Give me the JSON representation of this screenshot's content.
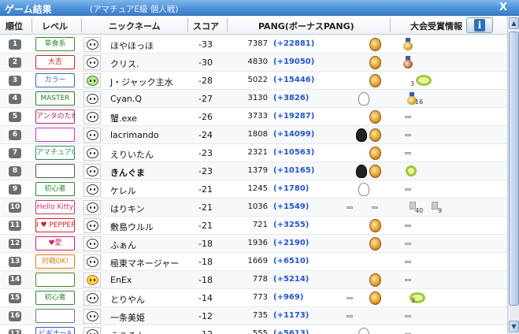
{
  "window": {
    "title": "ゲーム結果",
    "subtitle": "(アマチュアE級 個人戦)",
    "close_label": "X"
  },
  "header": {
    "rank": "順位",
    "level": "レベル",
    "nickname": "ニックネーム",
    "score": "スコア",
    "pang": "PANG(ボーナスPANG)",
    "tournament_info": "大会受賞情報",
    "info_icon_label": "i"
  },
  "rows": [
    {
      "rank": "1",
      "level": "草食系",
      "nickname": "ほやほっほ",
      "score": "-33",
      "pang": "7387",
      "bonus": "(+22881)",
      "level_color": "#2e8b2e"
    },
    {
      "rank": "2",
      "level": "大吉",
      "nickname": "クリス.",
      "score": "-30",
      "pang": "4830",
      "bonus": "(+19050)",
      "level_color": "#cc2222"
    },
    {
      "rank": "3",
      "level": "カラー",
      "nickname": "J・ジャック主水",
      "score": "-28",
      "pang": "5022",
      "bonus": "(+15446)",
      "level_color": "#3a6ab0",
      "ring_count": "3"
    },
    {
      "rank": "4",
      "level": "MASTER",
      "nickname": "Cyan.Q",
      "score": "-27",
      "pang": "3130",
      "bonus": "(+3826)",
      "level_color": "#2a7a2a",
      "trophy_count": "16"
    },
    {
      "rank": "5",
      "level": "アンタのためじゃないんだからね!",
      "nickname": "蟹.exe",
      "score": "-26",
      "pang": "3733",
      "bonus": "(+19287)",
      "level_color": "#aa2266"
    },
    {
      "rank": "6",
      "level": "",
      "nickname": "lacrimando",
      "score": "-24",
      "pang": "1808",
      "bonus": "(+14099)",
      "level_color": "#cc33cc"
    },
    {
      "rank": "7",
      "level": "アマチュアC",
      "nickname": "えりいたん",
      "score": "-23",
      "pang": "2321",
      "bonus": "(+10563)",
      "level_color": "#2e8b57"
    },
    {
      "rank": "8",
      "level": "",
      "nickname": "きんぐま",
      "score": "-23",
      "pang": "1379",
      "bonus": "(+10165)",
      "level_color": "#555555",
      "bold": true
    },
    {
      "rank": "9",
      "level": "初心者",
      "nickname": "ケレル",
      "score": "-21",
      "pang": "1245",
      "bonus": "(+1780)",
      "level_color": "#2a8a2a"
    },
    {
      "rank": "10",
      "level": "Hello Kitty",
      "nickname": "はりキン",
      "score": "-21",
      "pang": "1036",
      "bonus": "(+1549)",
      "level_color": "#cc3366",
      "count_a": "40",
      "count_b": "9"
    },
    {
      "rank": "11",
      "level": "I ♥ PEPPER",
      "nickname": "敷島ウルル",
      "score": "-21",
      "pang": "721",
      "bonus": "(+3255)",
      "level_color": "#cc2222"
    },
    {
      "rank": "12",
      "level": "♥愛",
      "nickname": "ふぁん",
      "score": "-18",
      "pang": "1936",
      "bonus": "(+2190)",
      "level_color": "#cc2266"
    },
    {
      "rank": "13",
      "level": "対戦OK!",
      "nickname": "極東マネージャー",
      "score": "-18",
      "pang": "1669",
      "bonus": "(+6510)",
      "level_color": "#e07a10"
    },
    {
      "rank": "14",
      "level": "",
      "nickname": "EnEx",
      "score": "-18",
      "pang": "778",
      "bonus": "(+5214)",
      "level_color": "#4a8a2a"
    },
    {
      "rank": "15",
      "level": "初心者",
      "nickname": "とりやん",
      "score": "-14",
      "pang": "773",
      "bonus": "(+969)",
      "level_color": "#2a8a2a",
      "ring_count": "3"
    },
    {
      "rank": "16",
      "level": "",
      "nickname": "一条美姫",
      "score": "-12",
      "pang": "735",
      "bonus": "(+1173)",
      "level_color": "#777777"
    },
    {
      "rank": "17",
      "level": "ビギナーA",
      "nickname": "えこるん。",
      "score": "-12",
      "pang": "555",
      "bonus": "(+5613)",
      "level_color": "#3355cc"
    }
  ],
  "scrollbar": {
    "up": "▲",
    "down": "▼"
  }
}
